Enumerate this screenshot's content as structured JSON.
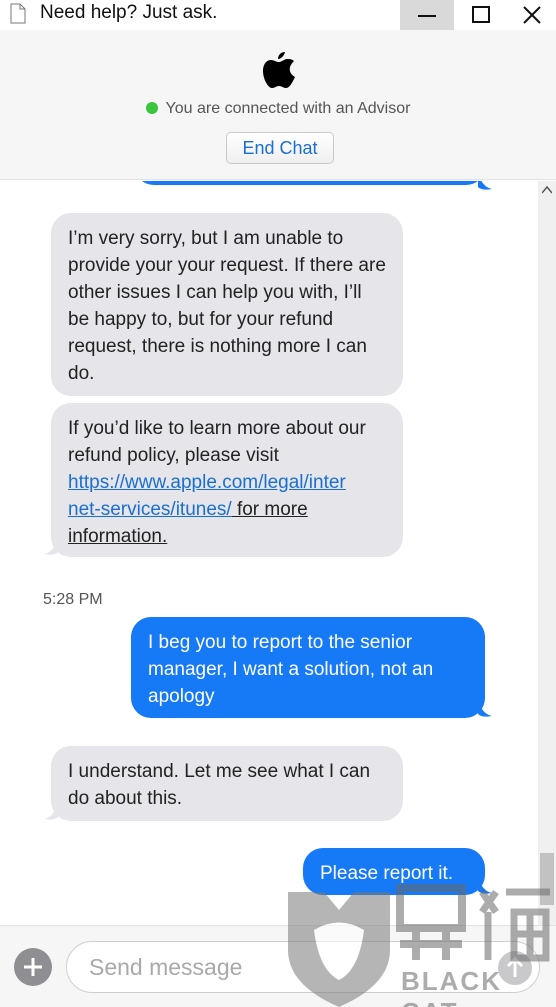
{
  "window": {
    "title": "Need help? Just ask.",
    "minimize_icon": "minimize-icon",
    "maximize_icon": "maximize-icon",
    "close_icon": "close-icon"
  },
  "header": {
    "logo": "apple-logo",
    "status_text": "You are connected with an Advisor",
    "status_color": "#3cc63f",
    "end_chat_label": "End Chat"
  },
  "messages": {
    "m1": {
      "sender": "advisor",
      "text": "I’m very sorry, but I am unable to provide your your request. If there are other issues I can help you with, I’ll be happy to, but for your refund request, there is nothing more I can do."
    },
    "m2": {
      "sender": "advisor",
      "text_before": "If you’d like to learn more about our refund policy, please visit ",
      "link": "https://www.apple.com/legal/internet-services/itunes/",
      "link_part1": "https://www.apple.com/legal/inter",
      "link_part2": "net-services/itunes/",
      "text_after_1": " for more",
      "text_after_2": "information."
    },
    "timestamp": "5:28 PM",
    "m3": {
      "sender": "user",
      "text": "I beg you to report to the senior manager, I want a solution, not an apology"
    },
    "m4": {
      "sender": "advisor",
      "text": "I understand. Let me see what I can do about this."
    },
    "m5": {
      "sender": "user",
      "text": "Please report it."
    }
  },
  "input": {
    "placeholder": "Send message",
    "value": "",
    "add_icon": "plus-icon",
    "send_icon": "send-icon"
  },
  "watermark": {
    "text": "BLACK CAT"
  },
  "colors": {
    "user_bubble": "#1679f5",
    "advisor_bubble": "#e5e5ea",
    "link": "#1a6fd1"
  }
}
